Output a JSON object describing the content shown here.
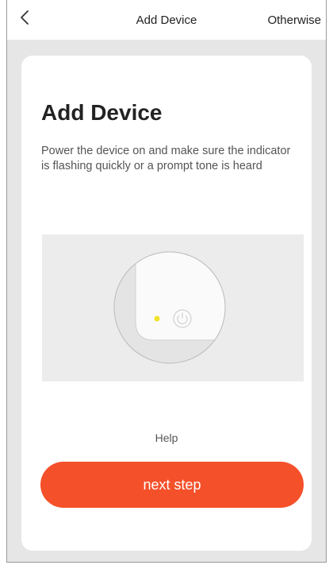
{
  "header": {
    "title": "Add Device",
    "otherwise_label": "Otherwise"
  },
  "card": {
    "title": "Add Device",
    "instruction": "Power the device on and make sure the indicator is flashing quickly or a prompt tone is heard",
    "help_label": "Help",
    "next_label": "next step"
  },
  "colors": {
    "accent": "#f4502a",
    "indicator": "#f1e22c",
    "background": "#e6e6e6"
  },
  "icons": {
    "back": "chevron-left-icon",
    "power": "power-icon"
  }
}
